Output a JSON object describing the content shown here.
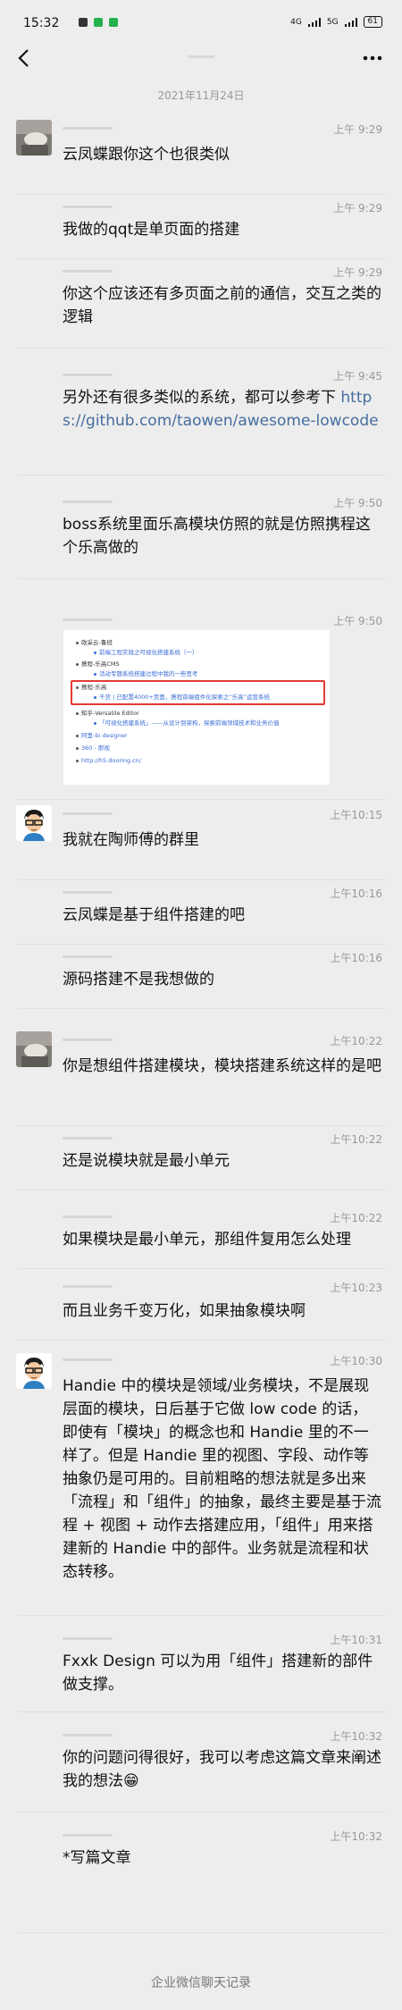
{
  "status_bar": {
    "time": "15:32",
    "network_1": "4G",
    "network_2": "5G",
    "battery": "61"
  },
  "nav": {
    "back_icon": "chevron-left-icon",
    "more_icon": "more-dots-icon"
  },
  "date_separator": "2021年11月24日",
  "messages": [
    {
      "time": "上午 9:29",
      "avatar": "photo",
      "text": "云凤蝶跟你这个也很类似"
    },
    {
      "time": "上午 9:29",
      "text": "我做的qqt是单页面的搭建"
    },
    {
      "time": "上午 9:29",
      "text": "你这个应该还有多页面之前的通信，交互之类的逻辑"
    },
    {
      "time": "上午 9:45",
      "text_before": "另外还有很多类似的系统，都可以参考下 ",
      "link": "https://github.com/taowen/awesome-lowcode"
    },
    {
      "time": "上午 9:50",
      "text": "boss系统里面乐高模块仿照的就是仿照携程这个乐高做的"
    },
    {
      "time": "上午 9:50",
      "image": {
        "lines": [
          "政采云-鲁班",
          "前端工程实践之可视化搭建系统（一）",
          "携程-乐高CMS",
          "活动专题系统搭建过程中我的一些思考",
          "携程-乐高",
          "干货 | 已配置4000+页面，携程前端组件化探索之“乐高”运营系统",
          "知乎-Versatile Editor",
          "「可视化搭建系统」——从设计到架构，探索前端领域技术和业务价值",
          "阿里-bi designer",
          "360 - 即视",
          "http://h5.dooring.cn/"
        ]
      }
    },
    {
      "time": "上午10:15",
      "avatar": "cartoon",
      "text": "我就在陶师傅的群里"
    },
    {
      "time": "上午10:16",
      "text": "云凤蝶是基于组件搭建的吧"
    },
    {
      "time": "上午10:16",
      "text": "源码搭建不是我想做的"
    },
    {
      "time": "上午10:22",
      "avatar": "photo",
      "text": "你是想组件搭建模块，模块搭建系统这样的是吧"
    },
    {
      "time": "上午10:22",
      "text": "还是说模块就是最小单元"
    },
    {
      "time": "上午10:22",
      "text": "如果模块是最小单元，那组件复用怎么处理"
    },
    {
      "time": "上午10:23",
      "text": "而且业务千变万化，如果抽象模块啊"
    },
    {
      "time": "上午10:30",
      "avatar": "cartoon",
      "text": "Handie 中的模块是领域/业务模块，不是展现层面的模块，日后基于它做 low code 的话，即使有「模块」的概念也和 Handie 里的不一样了。但是 Handie 里的视图、字段、动作等抽象仍是可用的。目前粗略的想法就是多出来「流程」和「组件」的抽象，最终主要是基于流程 + 视图 + 动作去搭建应用，「组件」用来搭建新的 Handie 中的部件。业务就是流程和状态转移。"
    },
    {
      "time": "上午10:31",
      "text": "Fxxk Design 可以为用「组件」搭建新的部件做支撑。"
    },
    {
      "time": "上午10:32",
      "text": "你的问题问得很好，我可以考虑这篇文章来阐述我的想法😁"
    },
    {
      "time": "上午10:32",
      "text": "*写篇文章"
    }
  ],
  "footer": "企业微信聊天记录",
  "colors": {
    "background": "#ededed",
    "link": "#466d9f",
    "highlight": "#e53935",
    "time": "#999999"
  }
}
